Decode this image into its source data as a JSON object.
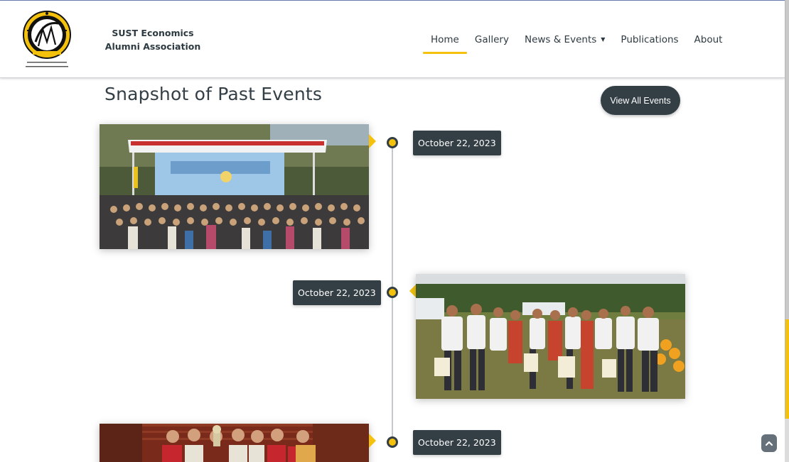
{
  "site": {
    "name": "SUST Economics Alumni Association",
    "logo_text_top": "SUST",
    "logo_text_middle": "ECONOMICS",
    "logo_text_bottom": "ALUMNI ASSOCIATION"
  },
  "nav": {
    "items": [
      {
        "label": "Home",
        "active": true
      },
      {
        "label": "Gallery",
        "active": false
      },
      {
        "label": "News & Events",
        "active": false,
        "has_dropdown": true
      },
      {
        "label": "Publications",
        "active": false
      },
      {
        "label": "About",
        "active": false
      }
    ]
  },
  "section": {
    "title": "Snapshot of Past Events",
    "view_all_label": "View All Events"
  },
  "events": [
    {
      "date": "October 22, 2023",
      "image": "group-photo-under-stage-canopy",
      "side": "left"
    },
    {
      "date": "October 22, 2023",
      "image": "group-photo-in-garden",
      "side": "right"
    },
    {
      "date": "October 22, 2023",
      "image": "trophy-group-photo",
      "side": "left"
    }
  ],
  "icons": {
    "back_to_top": "chevron-up-icon",
    "dropdown": "caret-down-icon"
  },
  "colors": {
    "accent": "#f4c20d",
    "dark": "#333e45",
    "timeline": "#c4c8cb"
  }
}
